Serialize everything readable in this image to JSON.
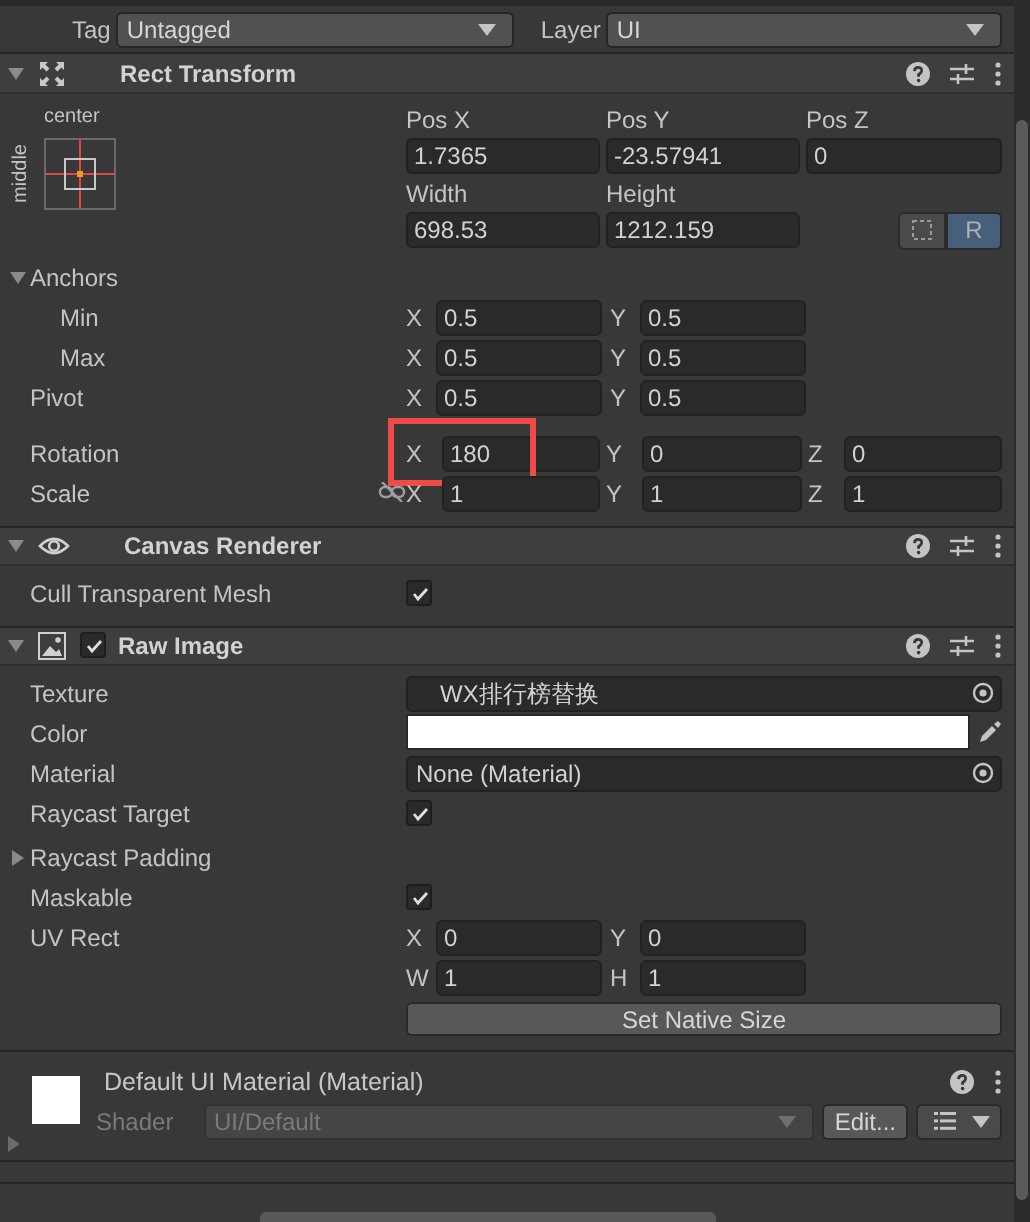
{
  "header": {
    "tag_label": "Tag",
    "tag": "Untagged",
    "layer_label": "Layer",
    "layer": "UI"
  },
  "components": [
    {
      "kind": "rect_transform",
      "title": "Rect Transform",
      "expanded": true,
      "anchor_preset": {
        "horizontal": "center",
        "vertical": "middle"
      },
      "position": [
        {
          "label": "Pos X",
          "value": "1.7365"
        },
        {
          "label": "Pos Y",
          "value": "-23.57941"
        },
        {
          "label": "Pos Z",
          "value": "0"
        }
      ],
      "size": [
        {
          "label": "Width",
          "value": "698.53"
        },
        {
          "label": "Height",
          "value": "1212.159"
        }
      ],
      "raw_edit": {
        "label": "R",
        "selected": true
      },
      "rows": [
        {
          "kind": "group",
          "label": "Anchors",
          "expanded": true,
          "children": [
            {
              "kind": "vector",
              "label": "Min",
              "fields": [
                {
                  "axis": "X",
                  "value": "0.5"
                },
                {
                  "axis": "Y",
                  "value": "0.5"
                }
              ]
            },
            {
              "kind": "vector",
              "label": "Max",
              "fields": [
                {
                  "axis": "X",
                  "value": "0.5"
                },
                {
                  "axis": "Y",
                  "value": "0.5"
                }
              ]
            }
          ]
        },
        {
          "kind": "vector",
          "label": "Pivot",
          "fields": [
            {
              "axis": "X",
              "value": "0.5"
            },
            {
              "axis": "Y",
              "value": "0.5"
            }
          ]
        },
        {
          "kind": "vector",
          "label": "Rotation",
          "fields": [
            {
              "axis": "X",
              "value": "180",
              "highlighted": true
            },
            {
              "axis": "Y",
              "value": "0"
            },
            {
              "axis": "Z",
              "value": "0"
            }
          ]
        },
        {
          "kind": "vector",
          "label": "Scale",
          "constrain_proportions": false,
          "fields": [
            {
              "axis": "X",
              "value": "1"
            },
            {
              "axis": "Y",
              "value": "1"
            },
            {
              "axis": "Z",
              "value": "1"
            }
          ]
        }
      ]
    },
    {
      "kind": "canvas_renderer",
      "title": "Canvas Renderer",
      "expanded": true,
      "rows": [
        {
          "kind": "checkbox",
          "label": "Cull Transparent Mesh",
          "checked": true
        }
      ]
    },
    {
      "kind": "raw_image",
      "title": "Raw Image",
      "expanded": true,
      "enabled": true,
      "rows": [
        {
          "kind": "texture",
          "label": "Texture",
          "value": "WX排行榜替换"
        },
        {
          "kind": "color",
          "label": "Color",
          "color": "#ffffff"
        },
        {
          "kind": "object",
          "label": "Material",
          "value": "None (Material)"
        },
        {
          "kind": "checkbox",
          "label": "Raycast Target",
          "checked": true
        },
        {
          "kind": "foldout",
          "label": "Raycast Padding",
          "expanded": false
        },
        {
          "kind": "checkbox",
          "label": "Maskable",
          "checked": true
        },
        {
          "kind": "vector",
          "label": "UV Rect",
          "fields": [
            {
              "axis": "X",
              "value": "0"
            },
            {
              "axis": "Y",
              "value": "0"
            }
          ]
        },
        {
          "kind": "vector",
          "label": "",
          "fields": [
            {
              "axis": "W",
              "value": "1"
            },
            {
              "axis": "H",
              "value": "1"
            }
          ]
        },
        {
          "kind": "button",
          "label": "Set Native Size"
        }
      ]
    }
  ],
  "material": {
    "title": "Default UI Material (Material)",
    "shader_label": "Shader",
    "shader": "UI/Default",
    "edit_button": "Edit..."
  }
}
